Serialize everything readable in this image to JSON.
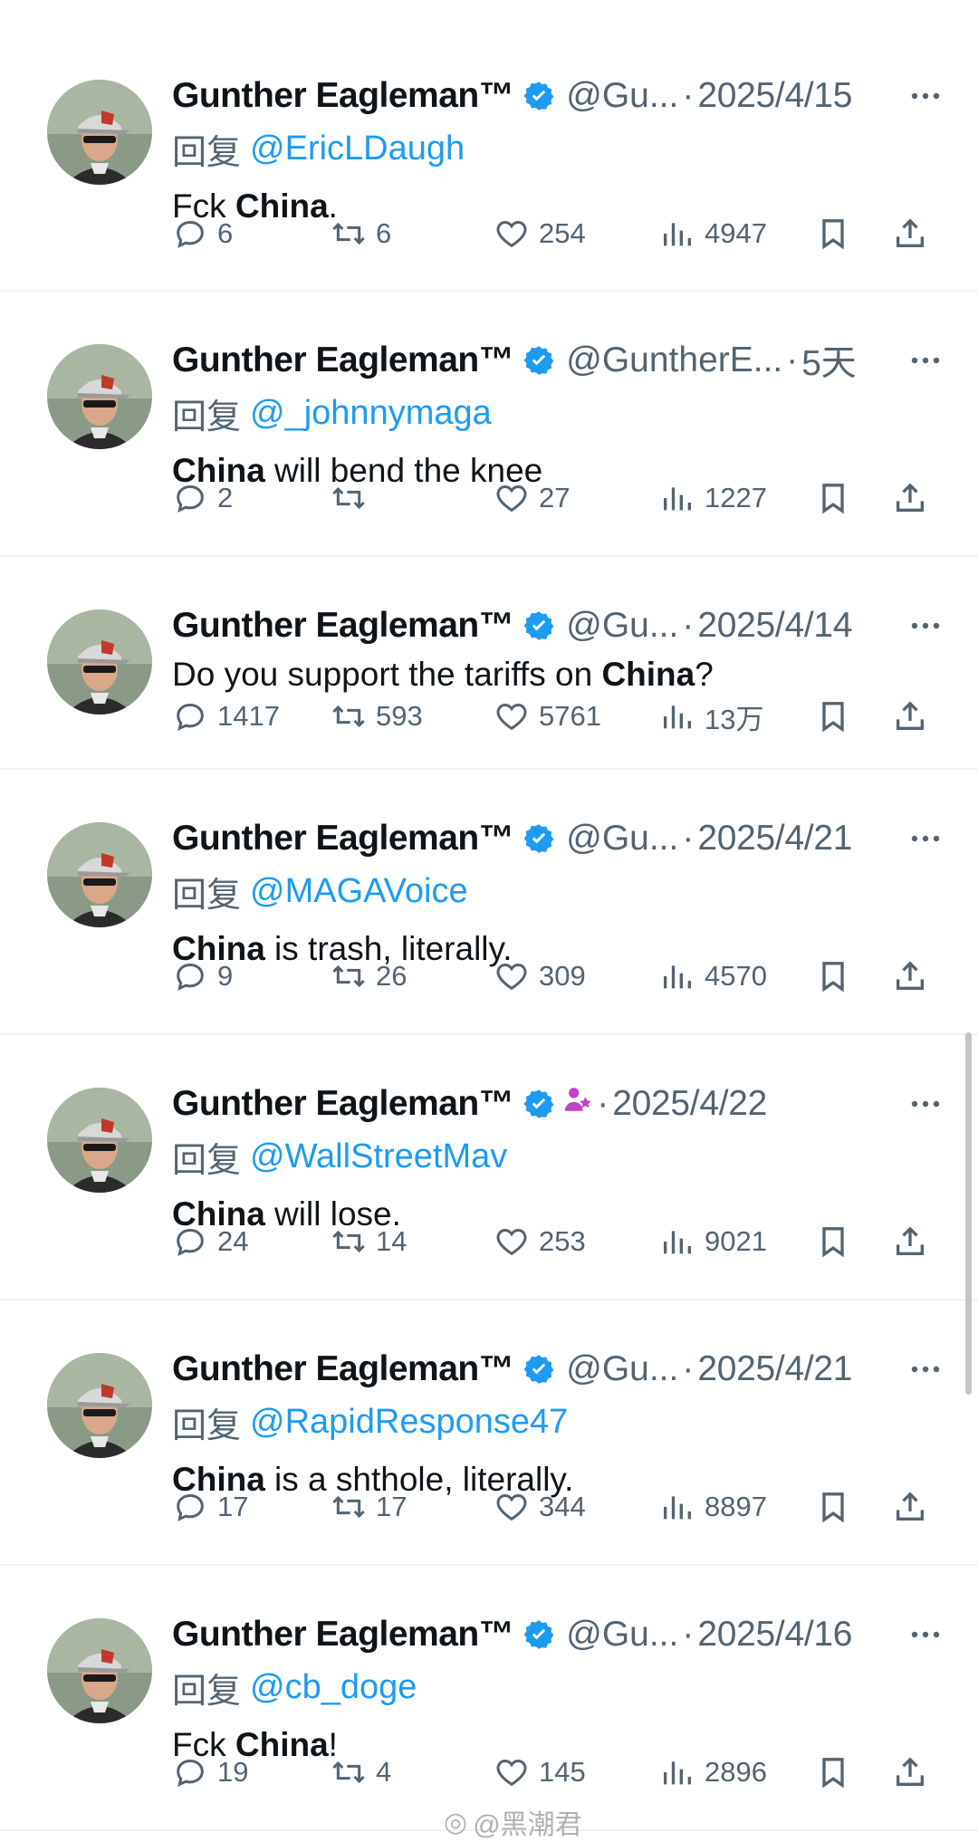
{
  "tweets": [
    {
      "name": "Gunther Eagleman™",
      "handle": "@Gu...",
      "date": "2025/4/15",
      "reply_prefix": "回复",
      "reply_to": "@EricLDaugh",
      "text_pre": "Fck ",
      "text_bold": "China",
      "text_post": ".",
      "bold_first": false,
      "replies": "6",
      "retweets": "6",
      "likes": "254",
      "views": "4947",
      "extra_badge": false
    },
    {
      "name": "Gunther Eagleman™",
      "handle": "@GuntherE...",
      "date": "5天",
      "reply_prefix": "回复",
      "reply_to": "@_johnnymaga",
      "text_pre": "",
      "text_bold": "China",
      "text_post": " will bend the knee",
      "bold_first": true,
      "replies": "2",
      "retweets": "",
      "likes": "27",
      "views": "1227",
      "extra_badge": false
    },
    {
      "name": "Gunther Eagleman™",
      "handle": "@Gu...",
      "date": "2025/4/14",
      "reply_prefix": "",
      "reply_to": "",
      "text_pre": "Do you support the tariffs on ",
      "text_bold": "China",
      "text_post": "?",
      "bold_first": false,
      "replies": "1417",
      "retweets": "593",
      "likes": "5761",
      "views": "13万",
      "extra_badge": false
    },
    {
      "name": "Gunther Eagleman™",
      "handle": "@Gu...",
      "date": "2025/4/21",
      "reply_prefix": "回复",
      "reply_to": "@MAGAVoice",
      "text_pre": "",
      "text_bold": "China",
      "text_post": " is trash, literally.",
      "bold_first": true,
      "replies": "9",
      "retweets": "26",
      "likes": "309",
      "views": "4570",
      "extra_badge": false
    },
    {
      "name": "Gunther Eagleman™",
      "handle": "",
      "date": "2025/4/22",
      "reply_prefix": "回复",
      "reply_to": "@WallStreetMav",
      "text_pre": "",
      "text_bold": "China",
      "text_post": " will lose.",
      "bold_first": true,
      "replies": "24",
      "retweets": "14",
      "likes": "253",
      "views": "9021",
      "extra_badge": true
    },
    {
      "name": "Gunther Eagleman™",
      "handle": "@Gu...",
      "date": "2025/4/21",
      "reply_prefix": "回复",
      "reply_to": "@RapidResponse47",
      "text_pre": "",
      "text_bold": "China",
      "text_post": " is a shthole, literally.",
      "bold_first": true,
      "replies": "17",
      "retweets": "17",
      "likes": "344",
      "views": "8897",
      "extra_badge": false
    },
    {
      "name": "Gunther Eagleman™",
      "handle": "@Gu...",
      "date": "2025/4/16",
      "reply_prefix": "回复",
      "reply_to": "@cb_doge",
      "text_pre": "Fck ",
      "text_bold": "China",
      "text_post": "!",
      "bold_first": false,
      "replies": "19",
      "retweets": "4",
      "likes": "145",
      "views": "2896",
      "extra_badge": false
    }
  ],
  "separator": "·",
  "watermark": "@黑潮君",
  "colors": {
    "accent": "#1d9bf0",
    "muted": "#536471",
    "verified": "#1d9bf0"
  }
}
